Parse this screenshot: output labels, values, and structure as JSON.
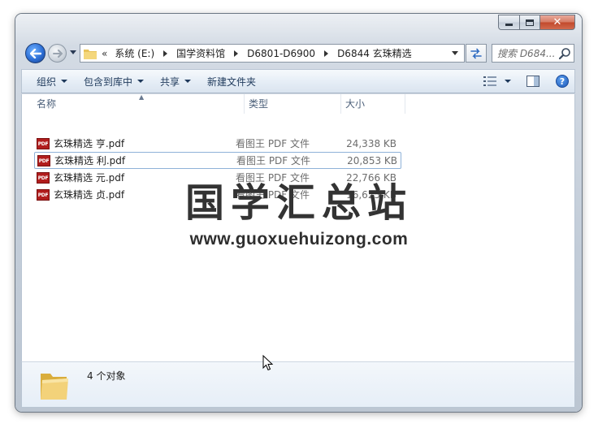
{
  "window": {
    "caption_buttons": {
      "minimize": "minimize",
      "maximize": "maximize",
      "close": "close"
    }
  },
  "address_bar": {
    "overflow_chevron": "«",
    "breadcrumbs": [
      "系统 (E:)",
      "国学资料馆",
      "D6801-D6900",
      "D6844 玄珠精选"
    ]
  },
  "search": {
    "placeholder": "搜索 D684..."
  },
  "toolbar": {
    "organize": "组织",
    "include_in_library": "包含到库中",
    "share": "共享",
    "new_folder": "新建文件夹"
  },
  "columns": {
    "name": "名称",
    "type": "类型",
    "size": "大小"
  },
  "files": [
    {
      "name": "玄珠精选 亨.pdf",
      "type": "看图王 PDF 文件",
      "size": "24,338 KB",
      "selected": false
    },
    {
      "name": "玄珠精选 利.pdf",
      "type": "看图王 PDF 文件",
      "size": "20,853 KB",
      "selected": true
    },
    {
      "name": "玄珠精选 元.pdf",
      "type": "看图王 PDF 文件",
      "size": "22,766 KB",
      "selected": false
    },
    {
      "name": "玄珠精选 贞.pdf",
      "type": "看图王 PDF 文件",
      "size": "16,625 KB",
      "selected": false
    }
  ],
  "file_icon_text": "PDF",
  "details": {
    "count": "4 个对象"
  },
  "watermark": {
    "title": "国学汇总站",
    "url": "www.guoxuehuizong.com"
  },
  "colors": {
    "pdf_icon": "#b11d1d",
    "toolbar_text": "#1e395b",
    "selection_border": "#8fb2d8"
  }
}
